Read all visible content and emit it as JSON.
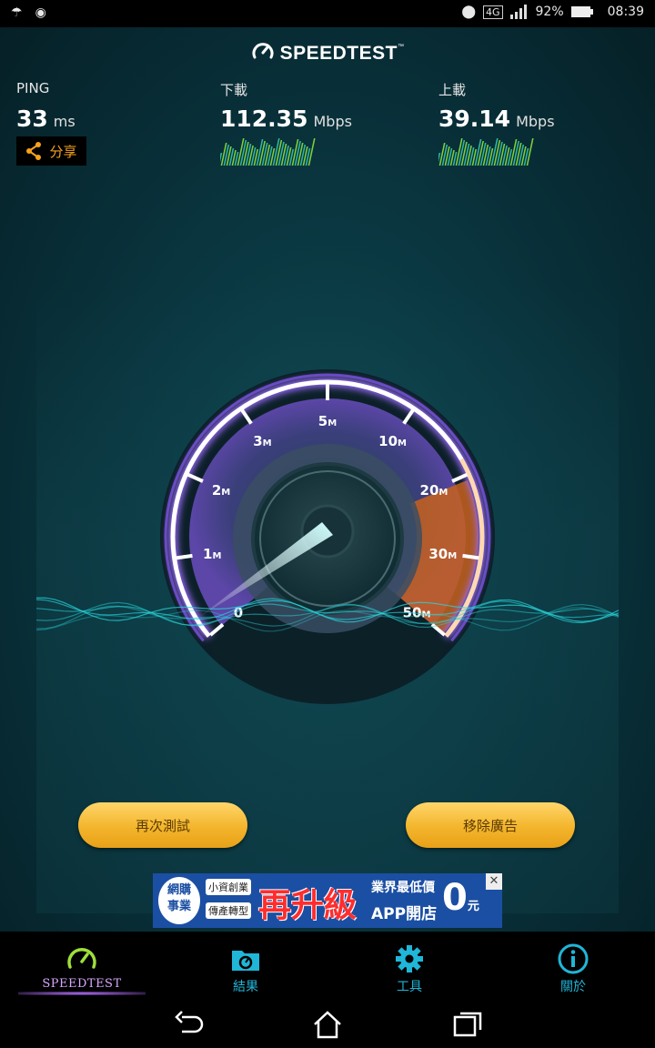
{
  "status_bar": {
    "network": "4G",
    "battery": "92%",
    "time": "08:39"
  },
  "app": {
    "logo_text": "SPEEDTEST",
    "trademark": "™",
    "ping": {
      "label": "PING",
      "value": "33",
      "unit": "ms"
    },
    "download": {
      "label": "下載",
      "value": "112.35",
      "unit": "Mbps"
    },
    "upload": {
      "label": "上載",
      "value": "39.14",
      "unit": "Mbps"
    },
    "share_label": "分享",
    "gauge": {
      "ticks": [
        "0",
        "1M",
        "2M",
        "3M",
        "5M",
        "10M",
        "20M",
        "30M",
        "50M"
      ],
      "needle_value": "0"
    },
    "buttons": {
      "retest": "再次測試",
      "remove_ads": "移除廣告"
    },
    "ad": {
      "line1": "網購",
      "line2": "事業",
      "tag1": "小資創業",
      "tag2": "傳產轉型",
      "headline": "再升級",
      "sub1": "業界最低價",
      "sub2": "APP開店",
      "price": "0",
      "price_unit": "元",
      "close": "✕"
    }
  },
  "bottom_nav": [
    {
      "label": "SPEEDTEST",
      "icon": "speedometer-icon"
    },
    {
      "label": "結果",
      "icon": "results-folder-icon"
    },
    {
      "label": "工具",
      "icon": "gear-icon"
    },
    {
      "label": "關於",
      "icon": "info-icon"
    }
  ],
  "colors": {
    "accent_cyan": "#20b6d8",
    "button_gold": "#f3b52c",
    "share_orange": "#f7a21b",
    "gauge_purple": "#8a5cf0",
    "gauge_orange": "#e07b20"
  }
}
